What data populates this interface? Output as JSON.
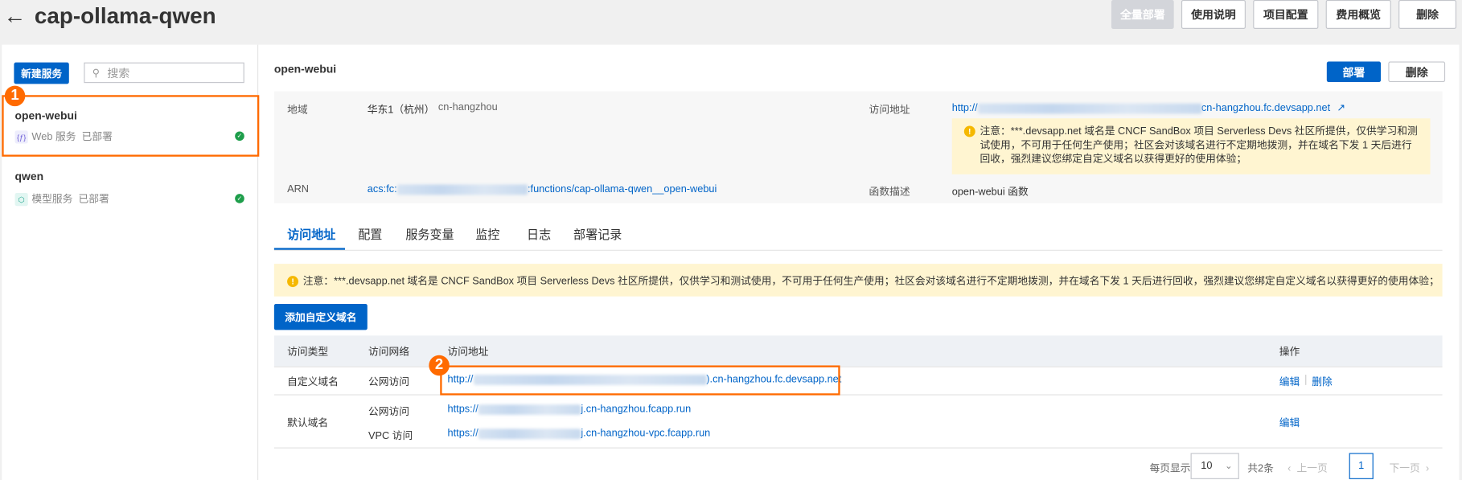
{
  "header": {
    "back_icon": "arrow-left-icon",
    "title": "cap-ollama-qwen",
    "buttons": {
      "deploy_all": "全量部署",
      "usage": "使用说明",
      "project_config": "项目配置",
      "cost_overview": "费用概览",
      "delete": "删除"
    }
  },
  "sidebar": {
    "new_service": "新建服务",
    "search_placeholder": "搜索",
    "items": [
      {
        "name": "open-webui",
        "type": "Web 服务",
        "status": "已部署",
        "icon": "web-function-icon"
      },
      {
        "name": "qwen",
        "type": "模型服务",
        "status": "已部署",
        "icon": "model-cube-icon"
      }
    ]
  },
  "annotations": {
    "one": "1",
    "two": "2"
  },
  "detail": {
    "title": "open-webui",
    "deploy": "部署",
    "delete": "删除",
    "region_label": "地域",
    "region_value": "华东1（杭州）",
    "region_code": "cn-hangzhou",
    "url_label": "访问地址",
    "url_prefix": "http://",
    "url_suffix": "cn-hangzhou.fc.devsapp.net",
    "notice": "注意：***.devsapp.net 域名是 CNCF SandBox 项目 Serverless Devs 社区所提供，仅供学习和测试使用，不可用于任何生产使用；社区会对该域名进行不定期地拨测，并在域名下发 1 天后进行回收，强烈建议您绑定自定义域名以获得更好的使用体验；",
    "arn_label": "ARN",
    "arn_prefix": "acs:fc:",
    "arn_suffix": ":functions/cap-ollama-qwen__open-webui",
    "desc_label": "函数描述",
    "desc_value": "open-webui 函数"
  },
  "tabs": [
    "访问地址",
    "配置",
    "服务变量",
    "监控",
    "日志",
    "部署记录"
  ],
  "access": {
    "notice": "注意：***.devsapp.net 域名是 CNCF SandBox 项目 Serverless Devs 社区所提供，仅供学习和测试使用，不可用于任何生产使用；社区会对该域名进行不定期地拨测，并在域名下发 1 天后进行回收，强烈建议您绑定自定义域名以获得更好的使用体验；",
    "add_domain": "添加自定义域名",
    "columns": [
      "访问类型",
      "访问网络",
      "访问地址",
      "操作"
    ],
    "rows": [
      {
        "type": "自定义域名",
        "network": "公网访问",
        "url_prefix": "http://",
        "url_suffix": ").cn-hangzhou.fc.devsapp.net",
        "edit": "编辑",
        "delete": "删除"
      },
      {
        "type": "默认域名",
        "network": "公网访问",
        "url_prefix": "https://",
        "url_suffix": "j.cn-hangzhou.fcapp.run",
        "network2": "VPC 访问",
        "url2_prefix": "https://",
        "url2_suffix": "j.cn-hangzhou-vpc.fcapp.run",
        "edit": "编辑"
      }
    ],
    "pagination": {
      "per_page_label": "每页显示",
      "per_page": "10",
      "total": "共2条",
      "prev": "上一页",
      "page": "1",
      "next": "下一页"
    }
  }
}
